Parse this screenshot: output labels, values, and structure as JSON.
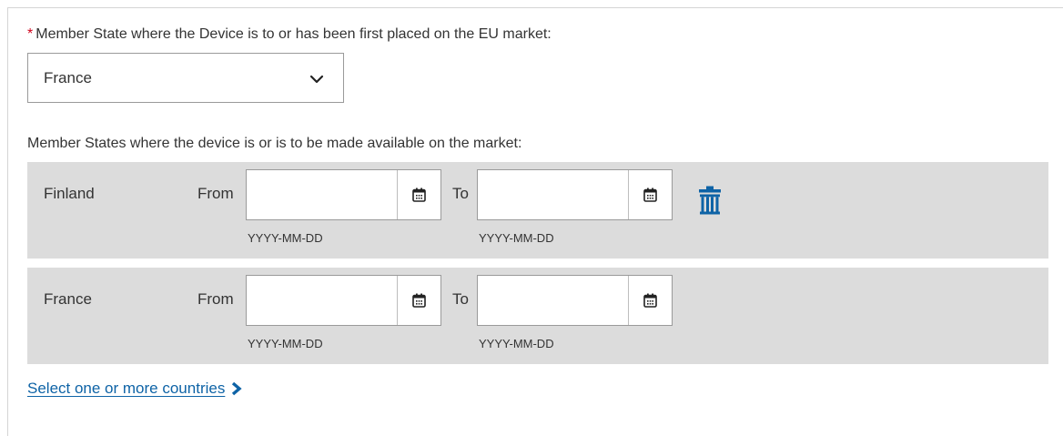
{
  "first_placed": {
    "required_marker": "*",
    "label": "Member State where the Device is to or has been first placed on the EU market:",
    "selected": "France"
  },
  "availability": {
    "label": "Member States where the device is or is to be made available on the market:",
    "from_label": "From",
    "to_label": "To",
    "date_format_hint": "YYYY-MM-DD",
    "rows": [
      {
        "country": "Finland",
        "from_value": "",
        "to_value": "",
        "deletable": true
      },
      {
        "country": "France",
        "from_value": "",
        "to_value": "",
        "deletable": false
      }
    ]
  },
  "select_countries_link": "Select one or more countries",
  "colors": {
    "accent": "#0e63a6",
    "required": "#d0021b",
    "row_background": "#dcdcdc"
  },
  "icons": {
    "dropdown": "chevron-down-icon",
    "calendar": "calendar-icon",
    "delete": "trash-icon",
    "link": "chevron-right-icon"
  }
}
